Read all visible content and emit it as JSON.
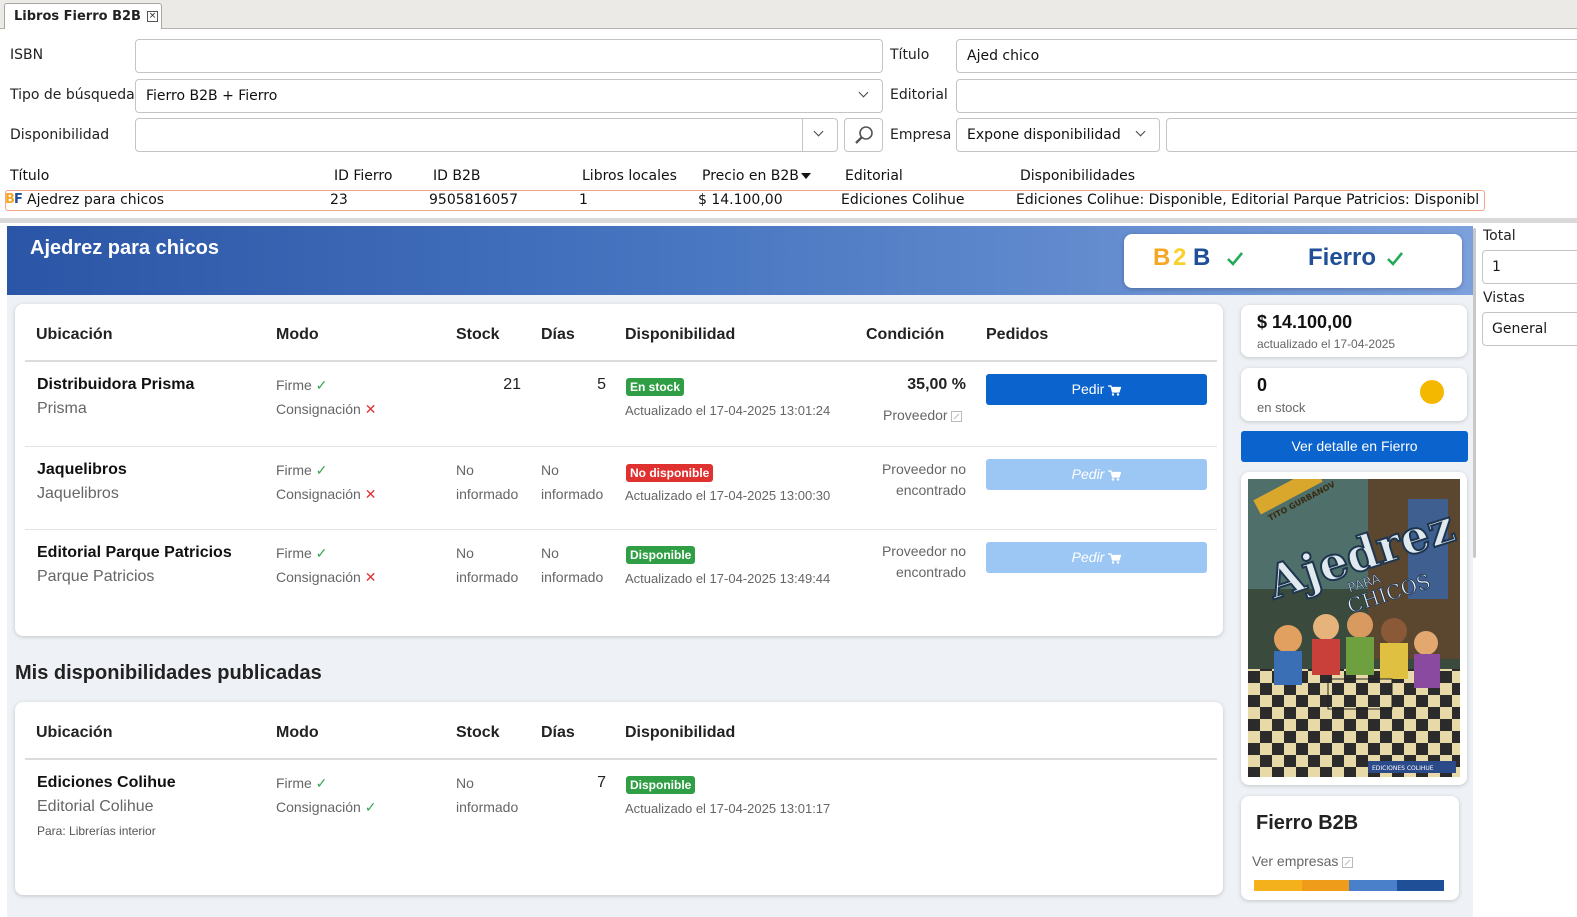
{
  "tab": {
    "title": "Libros Fierro B2B",
    "close": "×"
  },
  "search": {
    "isbn_label": "ISBN",
    "isbn_value": "",
    "titulo_label": "Título",
    "titulo_value": "Ajed chico",
    "tipo_label": "Tipo de búsqueda",
    "tipo_value": "Fierro B2B + Fierro",
    "editorial_label": "Editorial",
    "editorial_value": "",
    "disp_label": "Disponibilidad",
    "disp_value": "",
    "empresa_label": "Empresa",
    "empresa_value": "Expone disponibilidad",
    "empresa_extra": ""
  },
  "results": {
    "columns": [
      "Título",
      "ID Fierro",
      "ID B2B",
      "Libros locales",
      "Precio en B2B",
      "Editorial",
      "Disponibilidades"
    ],
    "row": {
      "prefix_b": "B",
      "prefix_f": "F",
      "titulo": "Ajedrez para chicos",
      "id_fierro": "23",
      "id_b2b": "9505816057",
      "libros_locales": "1",
      "precio": "$ 14.100,00",
      "editorial": "Ediciones Colihue",
      "disponibilidades": "Ediciones Colihue: Disponible, Editorial Parque Patricios: Disponible..."
    }
  },
  "detail": {
    "title": "Ajedrez para chicos",
    "logo_b2b": [
      "B",
      "2",
      "B"
    ],
    "logo_fierro": "Fierro",
    "colors": {
      "b_orange": "#f5a623",
      "two_yellow": "#f8d12f",
      "b_blue": "#1f4f96",
      "check": "#22aa55",
      "primary": "#0b63ce",
      "disabled": "#9cc7f5"
    },
    "availability": {
      "headers": [
        "Ubicación",
        "Modo",
        "Stock",
        "Días",
        "Disponibilidad",
        "Condición",
        "Pedidos"
      ],
      "rows": [
        {
          "name": "Distribuidora Prisma",
          "short": "Prisma",
          "firme": "Firme",
          "consig": "Consignación",
          "stock": "21",
          "dias": "5",
          "badge": "En stock",
          "badge_color": "#2f9e44",
          "updated": "Actualizado el 17-04-2025 13:01:24",
          "cond": "35,00 %",
          "cond2": "Proveedor",
          "btn": "Pedir",
          "btn_enabled": true
        },
        {
          "name": "Jaquelibros",
          "short": "Jaquelibros",
          "firme": "Firme",
          "consig": "Consignación",
          "stock1": "No",
          "stock2": "informado",
          "dias1": "No",
          "dias2": "informado",
          "badge": "No disponible",
          "badge_color": "#e03131",
          "updated": "Actualizado el 17-04-2025 13:00:30",
          "cond1": "Proveedor no",
          "cond2": "encontrado",
          "btn": "Pedir",
          "btn_enabled": false
        },
        {
          "name": "Editorial Parque Patricios",
          "short": "Parque Patricios",
          "firme": "Firme",
          "consig": "Consignación",
          "stock1": "No",
          "stock2": "informado",
          "dias1": "No",
          "dias2": "informado",
          "badge": "Disponible",
          "badge_color": "#2f9e44",
          "updated": "Actualizado el 17-04-2025 13:49:44",
          "cond1": "Proveedor no",
          "cond2": "encontrado",
          "btn": "Pedir",
          "btn_enabled": false
        }
      ]
    },
    "published_title": "Mis disponibilidades publicadas",
    "published": {
      "headers": [
        "Ubicación",
        "Modo",
        "Stock",
        "Días",
        "Disponibilidad"
      ],
      "row": {
        "name": "Ediciones Colihue",
        "short": "Editorial Colihue",
        "para": "Para: Librerías interior",
        "firme": "Firme",
        "consig": "Consignación",
        "stock1": "No",
        "stock2": "informado",
        "dias": "7",
        "badge": "Disponible",
        "updated": "Actualizado el 17-04-2025 13:01:17"
      }
    },
    "price": {
      "value": "$ 14.100,00",
      "updated": "actualizado el 17-04-2025"
    },
    "stock": {
      "value": "0",
      "label": "en stock",
      "dot_color": "#f5b800"
    },
    "ver_detalle": "Ver detalle en Fierro",
    "cover": {
      "author": "TITO GURBANOV",
      "title_main": "Ajedrez",
      "title_sub1": "PARA",
      "title_sub2": "CHICOS",
      "publisher": "EDICIONES COLIHUE"
    },
    "fierro_card": {
      "title": "Fierro B2B",
      "link": "Ver empresas",
      "bar_colors": [
        "#f5b11b",
        "#ef9c1a",
        "#4a7fc9",
        "#1f4f96"
      ]
    }
  },
  "sidebar": {
    "total_label": "Total",
    "total_value": "1",
    "vistas_label": "Vistas",
    "vistas_value": "General"
  }
}
